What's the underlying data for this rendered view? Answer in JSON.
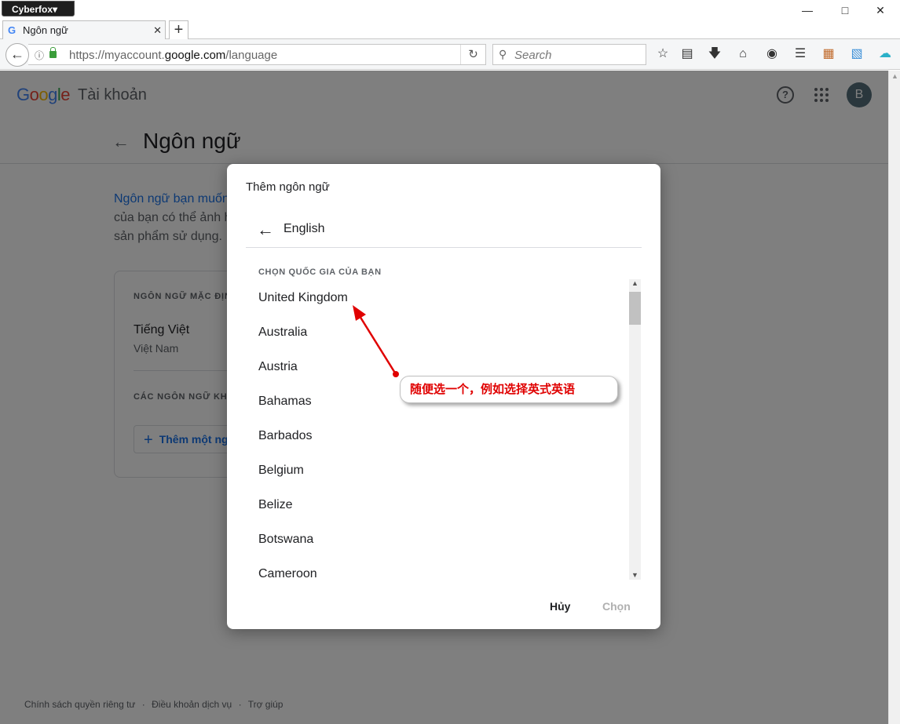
{
  "browser": {
    "app_menu": "Cyberfox▾",
    "tab_title": "Ngôn ngữ",
    "tab_favicon": "G",
    "url_prefix": "https://myaccount.",
    "url_domain": "google.com",
    "url_path": "/language",
    "search_placeholder": "Search"
  },
  "header": {
    "logo_letters": [
      "G",
      "o",
      "o",
      "g",
      "l",
      "e"
    ],
    "product": "Tài khoản",
    "avatar_letter": "B"
  },
  "page": {
    "title": "Ngôn ngữ",
    "desc_link": "Ngôn ngữ bạn muốn",
    "desc_line2": "của bạn có thể ảnh h",
    "desc_line3": "sản phẩm sử dụng.",
    "default_section": "NGÔN NGỮ MẶC ĐỊNH",
    "default_lang": "Tiếng Việt",
    "default_region": "Việt Nam",
    "other_section": "CÁC NGÔN NGỮ KHÁC",
    "add_button": "Thêm một ng"
  },
  "footer": [
    "Chính sách quyền riêng tư",
    "·",
    "Điều khoản dịch vụ",
    "·",
    "Trợ giúp"
  ],
  "dialog": {
    "title": "Thêm ngôn ngữ",
    "selected_language": "English",
    "section_label": "CHỌN QUỐC GIA CỦA BẠN",
    "countries": [
      "United Kingdom",
      "Australia",
      "Austria",
      "Bahamas",
      "Barbados",
      "Belgium",
      "Belize",
      "Botswana",
      "Cameroon"
    ],
    "cancel_label": "Hủy",
    "choose_label": "Chọn"
  },
  "annotation": {
    "text": "随便选一个，例如选择英式英语",
    "color": "#e00000"
  }
}
